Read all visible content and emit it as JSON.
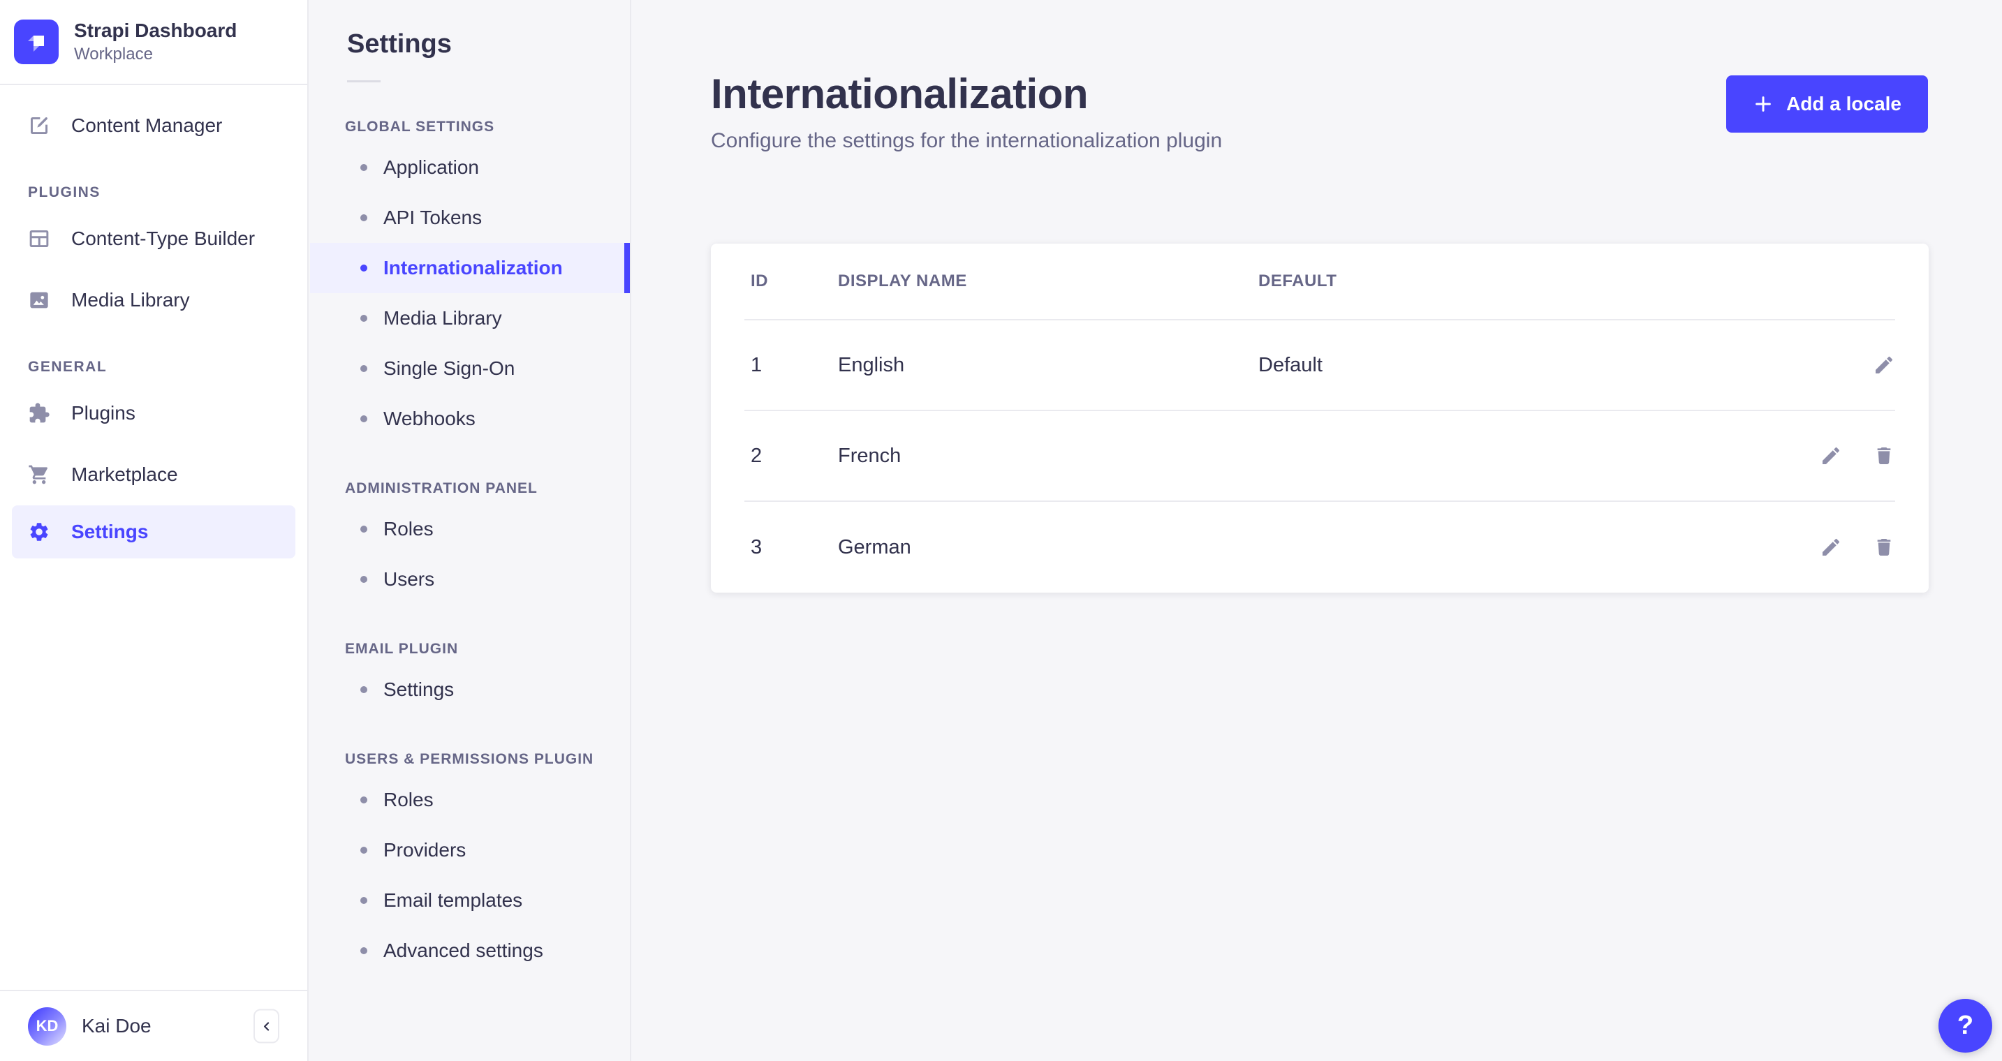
{
  "brand": {
    "name": "Strapi Dashboard",
    "workspace": "Workplace"
  },
  "sidebar": {
    "content_manager": "Content Manager",
    "plugins_label": "PLUGINS",
    "content_type_builder": "Content-Type Builder",
    "media_library": "Media Library",
    "general_label": "GENERAL",
    "plugins": "Plugins",
    "marketplace": "Marketplace",
    "settings": "Settings",
    "user": {
      "initials": "KD",
      "name": "Kai Doe"
    }
  },
  "subnav": {
    "title": "Settings",
    "global": {
      "label": "GLOBAL SETTINGS",
      "items": [
        "Application",
        "API Tokens",
        "Internationalization",
        "Media Library",
        "Single Sign-On",
        "Webhooks"
      ],
      "active_item": "Internationalization"
    },
    "admin": {
      "label": "ADMINISTRATION PANEL",
      "items": [
        "Roles",
        "Users"
      ]
    },
    "email": {
      "label": "EMAIL PLUGIN",
      "items": [
        "Settings"
      ]
    },
    "uperm": {
      "label": "USERS & PERMISSIONS PLUGIN",
      "items": [
        "Roles",
        "Providers",
        "Email templates",
        "Advanced settings"
      ]
    }
  },
  "main": {
    "title": "Internationalization",
    "subtitle": "Configure the settings for the internationalization plugin",
    "add_locale_button": "Add a locale",
    "table": {
      "col_id": "ID",
      "col_name": "DISPLAY NAME",
      "col_default": "DEFAULT",
      "rows": [
        {
          "id": "1",
          "name": "English",
          "default_label": "Default"
        },
        {
          "id": "2",
          "name": "French",
          "default_label": ""
        },
        {
          "id": "3",
          "name": "German",
          "default_label": ""
        }
      ]
    }
  },
  "help": {
    "label": "?"
  },
  "colors": {
    "primary": "#4945ff",
    "primary_light_bg": "#f0f0ff",
    "text_dark": "#32324d",
    "text_gray": "#666687",
    "icon_gray": "#8e8ea9",
    "border": "#eaeaef",
    "page_bg": "#f6f6f9",
    "card_bg": "#ffffff"
  }
}
